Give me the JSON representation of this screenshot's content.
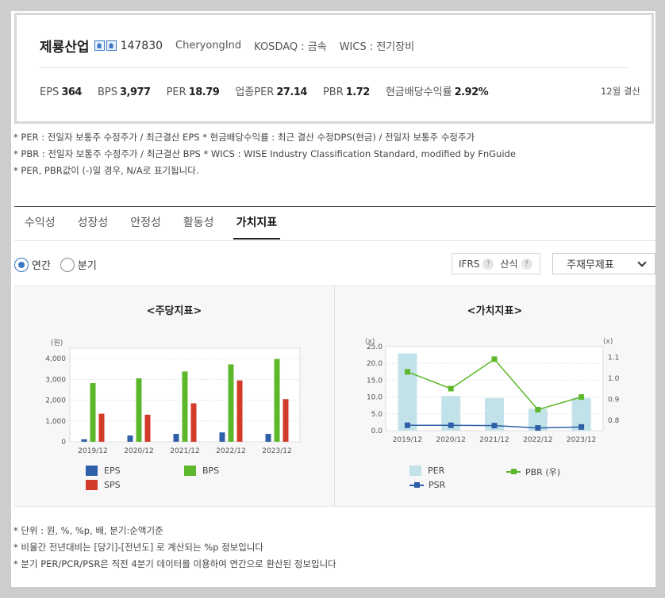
{
  "company": {
    "name": "제룡산업",
    "code": "147830",
    "english_name": "CheryongInd",
    "market": "KOSDAQ : 금속",
    "wics": "WICS : 전기장비"
  },
  "metrics": [
    {
      "label": "EPS",
      "value": "364"
    },
    {
      "label": "BPS",
      "value": "3,977"
    },
    {
      "label": "PER",
      "value": "18.79"
    },
    {
      "label": "업종PER",
      "value": "27.14"
    },
    {
      "label": "PBR",
      "value": "1.72"
    },
    {
      "label": "현금배당수익률",
      "value": "2.92%"
    }
  ],
  "settlement": "12월 결산",
  "notes_top": [
    "* PER : 전일자 보통주 수정주가 / 최근결산 EPS * 현금배당수익률 : 최근 결산 수정DPS(현금) / 전일자 보통주 수정주가",
    "* PBR : 전일자 보통주 수정주가 / 최근결산 BPS * WICS : WISE Industry Classification Standard, modified by FnGuide",
    "* PER, PBR값이 (-)일 경우, N/A로 표기됩니다."
  ],
  "tabs": [
    "수익성",
    "성장성",
    "안정성",
    "활동성",
    "가치지표"
  ],
  "active_tab": "가치지표",
  "period": {
    "annual": "연간",
    "quarter": "분기"
  },
  "controls": {
    "ifrs": "IFRS",
    "formula": "산식",
    "help": "?"
  },
  "select": {
    "value": "주재무제표"
  },
  "chart_data": [
    {
      "type": "bar",
      "title": "<주당지표>",
      "ylabel": "(원)",
      "categories": [
        "2019/12",
        "2020/12",
        "2021/12",
        "2022/12",
        "2023/12"
      ],
      "ylim": [
        0,
        4500
      ],
      "yticks": [
        "0",
        "1,000",
        "2,000",
        "3,000",
        "4,000"
      ],
      "series": [
        {
          "name": "EPS",
          "color": "#2f5fa8",
          "values": [
            120,
            300,
            380,
            450,
            380
          ]
        },
        {
          "name": "BPS",
          "color": "#5cb82a",
          "values": [
            2820,
            3050,
            3380,
            3720,
            3977
          ]
        },
        {
          "name": "SPS",
          "color": "#d23a2a",
          "values": [
            1350,
            1300,
            1850,
            2950,
            2050
          ]
        }
      ],
      "grid": true,
      "legend_position": "bottom"
    },
    {
      "type": "bar+line",
      "title": "<가치지표>",
      "ylabel_left": "(x)",
      "ylabel_right": "(x)",
      "categories": [
        "2019/12",
        "2020/12",
        "2021/12",
        "2022/12",
        "2023/12"
      ],
      "ylim_left": [
        0,
        25
      ],
      "yticks_left": [
        "0.0",
        "5.0",
        "10.0",
        "15.0",
        "20.0",
        "25.0"
      ],
      "ylim_right": [
        0.75,
        1.15
      ],
      "yticks_right": [
        "0.8",
        "0.9",
        "1.0",
        "1.1"
      ],
      "series": [
        {
          "name": "PER",
          "axis": "left",
          "kind": "bar",
          "color": "#c2e2ea",
          "values": [
            23.0,
            10.3,
            9.7,
            6.5,
            9.7
          ]
        },
        {
          "name": "PBR (우)",
          "axis": "right",
          "kind": "line",
          "color": "#5cb82a",
          "values": [
            1.03,
            0.95,
            1.09,
            0.85,
            0.91
          ]
        },
        {
          "name": "PSR",
          "axis": "left",
          "kind": "line",
          "color": "#2f5fa8",
          "values": [
            1.6,
            1.6,
            1.5,
            0.8,
            1.1
          ]
        }
      ],
      "grid": true,
      "legend_position": "bottom"
    }
  ],
  "notes_bottom": [
    "* 단위 : 원, %, %p, 배, 분기:순액기준",
    "* 비율간 전년대비는 [당기]-[전년도] 로 계산되는 %p 정보입니다",
    "* 분기 PER/PCR/PSR은 직전 4분기 데이터를 이용하여 연간으로 환산된 정보입니다"
  ]
}
